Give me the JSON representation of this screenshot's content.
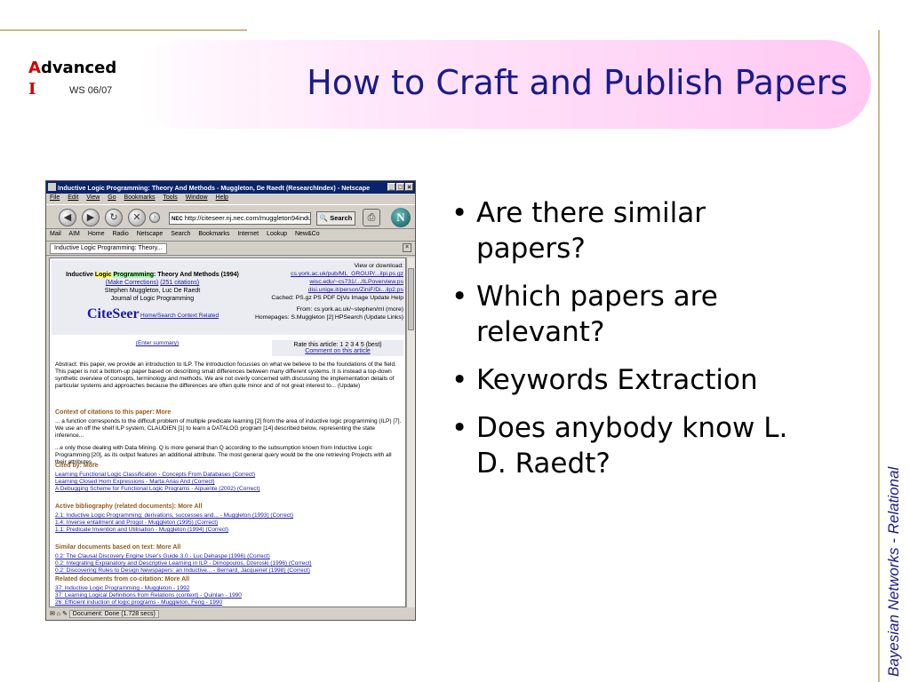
{
  "slide": {
    "logo_a_first": "A",
    "logo_a_rest": "dvanced",
    "logo_i": "I",
    "logo_ws": "WS 06/07",
    "title": "How to Craft and Publish Papers",
    "side_label": "Bayesian Networks  - Relational",
    "bullets": [
      "Are there similar papers?",
      "Which papers are relevant?",
      "Keywords Extraction",
      "Does anybody know L. D. Raedt?"
    ]
  },
  "browser": {
    "window_title": "Inductive Logic Programming: Theory And Methods - Muggleton, De Raedt (ResearchIndex) - Netscape",
    "menu": [
      "File",
      "Edit",
      "View",
      "Go",
      "Bookmarks",
      "Tools",
      "Window",
      "Help"
    ],
    "url": "http://citeseer.nj.nec.com/muggleton94induct",
    "search_label": "Search",
    "personal_bar": [
      "Mail",
      "AIM",
      "Home",
      "Radio",
      "Netscape",
      "Search",
      "Bookmarks",
      "Internet",
      "Lookup",
      "New&Co"
    ],
    "tab_label": "Inductive Logic Programming: Theory...",
    "status": "Document: Done (1.728 secs)",
    "page": {
      "title_pre": "Inductive ",
      "title_logic": "Logic",
      "title_prog": "Programming",
      "title_post": ": Theory And Methods (1994)",
      "make_corrections": "(Make Corrections)",
      "citations": "(251 citations)",
      "authors": "Stephen Muggleton, Luc De Raedt",
      "journal": "Journal of Logic Programming",
      "view_download": "View or download:",
      "download_links": [
        "cs.york.ac.uk/pub/ML_GROUP/...ilpi.ps.gz",
        "wisc.edu/~cs731/.../ILPoverview.ps",
        "disi.unige.it/person/ZiniF/Di...ilp2.ps"
      ],
      "cached": "Cached:  PS.gz  PS  PDF  DjVu  Image  Update  Help",
      "from": "From:  cs.york.ac.uk/~stephen/ml (more)",
      "homepages": "Homepages:  S.Muggleton  [2]  HPSearch  (Update Links)",
      "citeseer_logo": "CiteSeer",
      "citeseer_links": "Home/Search   Context   Related",
      "enter_summary": "(Enter summary)",
      "rate": "Rate this article:  1  2  3  4  5  (best)",
      "comment": "Comment on this article",
      "abstract": "Abstract: this paper, we provide an introduction to ILP. The introduction focusses on what we believe to be the foundations of the field. This paper is not a bottom-up paper based on describing small differences between many different systems. It is instead a top-down synthetic overview of concepts, terminology and methods. We are not overly concerned with discussing the implementation details of particular systems and approaches because the differences are often quite minor and of not great interest to... (Update)",
      "context_head": "Context of citations to this paper:  More",
      "context_1": "... a function corresponds to the difficult problem of multiple predicate learning [2] from the area of inductive logic programming (ILP) [7]. We use an off the shelf ILP system, CLAUDIEN [1] to learn a DATALOG program [14] described below, representing the state inference...",
      "context_2": "...e only those dealing with Data Mining. Q is more general than Q according to the subsumption known from Inductive Logic Programming [20], as its output features an additional attribute. The most general query would be the one retrieving Projects with all their attributes...",
      "cited_by_head": "Cited by:  More",
      "cited_by": [
        "Learning Functional Logic Classification - Concepts From Databases  (Correct)",
        "Learning Closed Horn Expressions - Marta Arias And  (Correct)",
        "A Debugging Scheme for Functional Logic Programs - Alpuente (2002)  (Correct)"
      ],
      "active_head": "Active bibliography (related documents):  More  All",
      "active": [
        "2.1:  Inductive Logic Programming: derivations, successes and... - Muggleton (1993)  (Correct)",
        "1.4:  Inverse entailment and Progol - Muggleton (1995)  (Correct)",
        "1.1:  Predicate Invention and Utilisation - Muggleton (1994)  (Correct)"
      ],
      "similar_head": "Similar documents based on text:  More  All",
      "similar": [
        "0.2:  The Clausal Discovery Engine User's Guide 3.0 - Luc Dehaspe (1996)  (Correct)",
        "0.2:  Integrating Explanatory and Descriptive Learning in ILP - Dimopoulos, Dzeroski (1996)  (Correct)",
        "0.2:  Discovering Rules to Design Newspapers: an Inductive... - Bernard, Jacquenet (1998)  (Correct)"
      ],
      "cocite_head": "Related documents from co-citation:  More  All",
      "cocite": [
        "37:  Inductive Logic Programming - Muggleton - 1992",
        "37:  Learning Logical Definitions from Relations (context) - Quinlan - 1990",
        "26:  Efficient induction of logic programs - Muggleton, Feng - 1990"
      ]
    }
  },
  "colors": {
    "title_text": "#1a1a8c",
    "logo_red": "#cc0000",
    "title_bar_pink": "#ffc8f3",
    "rule_tan": "#c9b98a"
  }
}
